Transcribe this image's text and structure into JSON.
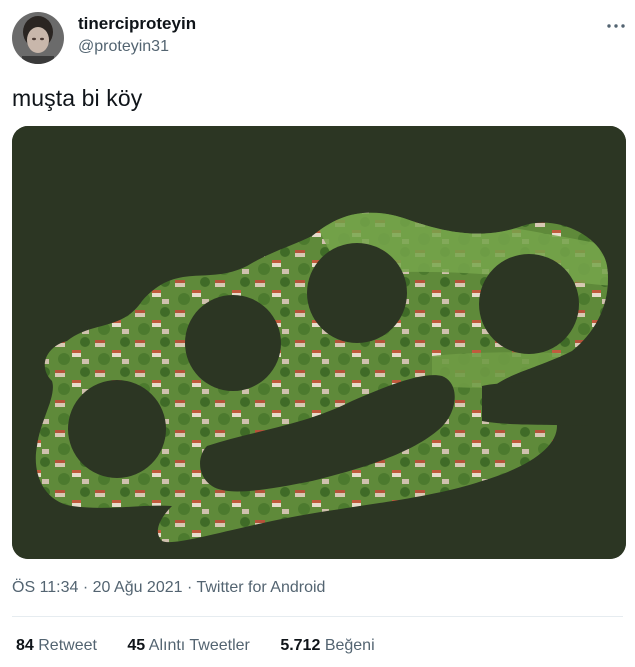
{
  "user": {
    "display_name": "tinerciproteyin",
    "handle": "@proteyin31"
  },
  "tweet": {
    "text": "muşta bi köy"
  },
  "meta": {
    "time": "ÖS 11:34",
    "sep1": "·",
    "date": "20 Ağu 2021",
    "sep2": "·",
    "source": "Twitter for Android"
  },
  "stats": {
    "retweets": {
      "count": "84",
      "label": "Retweet"
    },
    "quotes": {
      "count": "45",
      "label": "Alıntı Tweetler"
    },
    "likes": {
      "count": "5.712",
      "label": "Beğeni"
    }
  },
  "colors": {
    "text_primary": "#0f1419",
    "text_secondary": "#536471",
    "media_background": "#2c3623"
  },
  "icons": {
    "more": "more-dots-icon"
  }
}
